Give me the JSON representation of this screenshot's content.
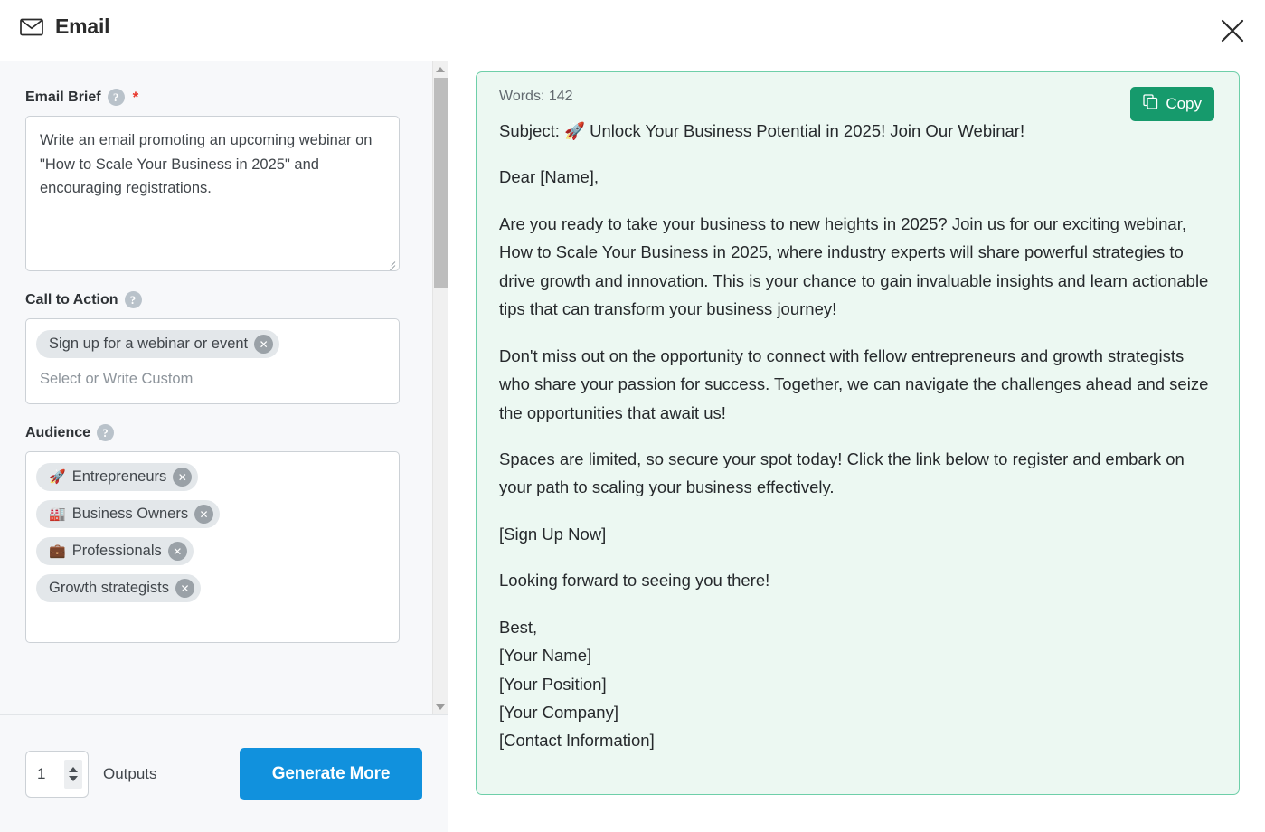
{
  "header": {
    "title": "Email",
    "mail_icon": "envelope-icon",
    "close_icon": "close-icon"
  },
  "form": {
    "fields": [
      {
        "label": "Email Brief",
        "help_icon": "help-circle-icon",
        "required_marker": "*",
        "value": "Write an email promoting an upcoming webinar on \"How to Scale Your Business in 2025\" and encouraging registrations."
      },
      {
        "label": "Call to Action",
        "help_icon": "help-circle-icon",
        "chips": [
          {
            "emoji": "",
            "text": "Sign up for a webinar or event"
          }
        ],
        "placeholder": "Select or Write Custom"
      },
      {
        "label": "Audience",
        "help_icon": "help-circle-icon",
        "chips": [
          {
            "emoji": "🚀",
            "text": "Entrepreneurs"
          },
          {
            "emoji": "🏭",
            "text": "Business Owners"
          },
          {
            "emoji": "💼",
            "text": "Professionals"
          },
          {
            "emoji": "",
            "text": "Growth strategists"
          }
        ]
      }
    ],
    "chip_remove_icon": "remove-chip-icon"
  },
  "footer": {
    "outputs_value": "1",
    "outputs_label": "Outputs",
    "generate_label": "Generate More"
  },
  "result": {
    "words_label": "Words: 142",
    "copy_label": "Copy",
    "copy_icon": "copy-icon",
    "subject": "Subject: 🚀 Unlock Your Business Potential in 2025! Join Our Webinar!",
    "greeting": "Dear [Name],",
    "paragraph1": "Are you ready to take your business to new heights in 2025? Join us for our exciting webinar, How to Scale Your Business in 2025, where industry experts will share powerful strategies to drive growth and innovation. This is your chance to gain invaluable insights and learn actionable tips that can transform your business journey!",
    "paragraph2": "Don't miss out on the opportunity to connect with fellow entrepreneurs and growth strategists who share your passion for success. Together, we can navigate the challenges ahead and seize the opportunities that await us!",
    "paragraph3": "Spaces are limited, so secure your spot today! Click the link below to register and embark on your path to scaling your business effectively.",
    "cta_link": "[Sign Up Now]",
    "closing": "Looking forward to seeing you there!",
    "sign_off": "Best,",
    "sig_name": "[Your Name]",
    "sig_position": "[Your Position]",
    "sig_company": "[Your Company]",
    "sig_contact": "[Contact Information]"
  },
  "colors": {
    "accent_blue": "#1191dd",
    "copy_green": "#169a6c",
    "panel_bg": "#ecf8f2",
    "panel_border": "#6ecfa9",
    "required_red": "#e8352a"
  }
}
